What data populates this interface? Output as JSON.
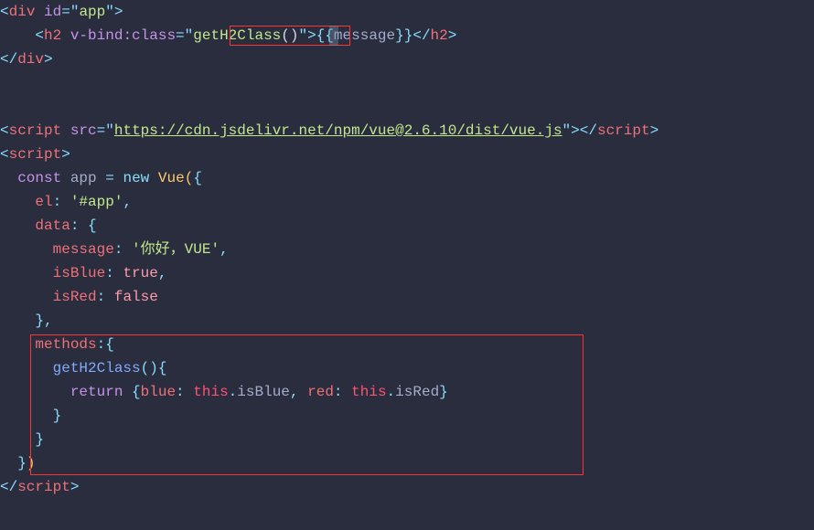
{
  "code": {
    "line1": {
      "tag_open": "<",
      "tag_name": "div",
      "attr_name": " id",
      "equals": "=",
      "quote1": "\"",
      "attr_value": "app",
      "quote2": "\"",
      "tag_close": ">"
    },
    "line2": {
      "indent": "    ",
      "tag_open": "<",
      "tag_name": "h2",
      "space": " ",
      "attr_name": "v-bind:class",
      "equals": "=",
      "quote1": "\"",
      "method": "getH2Class",
      "paren_open": "(",
      "paren_close": ")",
      "quote2": "\"",
      "tag_close": ">",
      "mustache_open": "{{",
      "mustache_var": "message",
      "mustache_close": "}}",
      "tag_close2_open": "</",
      "tag_name2": "h2",
      "tag_close2": ">"
    },
    "line3": {
      "tag_open": "</",
      "tag_name": "div",
      "tag_close": ">"
    },
    "line6": {
      "tag_open": "<",
      "tag_name": "script",
      "space": " ",
      "attr_name": "src",
      "equals": "=",
      "quote1": "\"",
      "url": "https://cdn.jsdelivr.net/npm/vue@2.6.10/dist/vue.js",
      "quote2": "\"",
      "tag_close": ">",
      "tag_close2_open": "</",
      "tag_name2": "script",
      "tag_close2": ">"
    },
    "line7": {
      "tag_open": "<",
      "tag_name": "script",
      "tag_close": ">"
    },
    "line8": {
      "indent": "  ",
      "const": "const",
      "space1": " ",
      "varname": "app",
      "space2": " ",
      "equals": "=",
      "space3": " ",
      "new": "new",
      "space4": " ",
      "classname": "Vue",
      "paren_open": "(",
      "brace_open": "{"
    },
    "line9": {
      "indent": "    ",
      "key": "el",
      "colon": ":",
      "space": " ",
      "value": "'#app'",
      "comma": ","
    },
    "line10": {
      "indent": "    ",
      "key": "data",
      "colon": ":",
      "space": " ",
      "brace": "{"
    },
    "line11": {
      "indent": "      ",
      "key": "message",
      "colon": ":",
      "space": " ",
      "value": "'你好，VUE'",
      "comma": ","
    },
    "line12": {
      "indent": "      ",
      "key": "isBlue",
      "colon": ":",
      "space": " ",
      "value": "true",
      "comma": ","
    },
    "line13": {
      "indent": "      ",
      "key": "isRed",
      "colon": ":",
      "space": " ",
      "value": "false"
    },
    "line14": {
      "indent": "    ",
      "brace": "}",
      "comma": ","
    },
    "line15": {
      "indent": "    ",
      "key": "methods",
      "colon": ":",
      "brace": "{"
    },
    "line16": {
      "indent": "      ",
      "method": "getH2Class",
      "paren_open": "(",
      "paren_close": ")",
      "brace": "{"
    },
    "line17": {
      "indent": "        ",
      "return": "return",
      "space1": " ",
      "brace_open": "{",
      "key1": "blue",
      "colon1": ":",
      "space2": " ",
      "this1": "this",
      "dot1": ".",
      "prop1": "isBlue",
      "comma": ",",
      "space3": " ",
      "key2": "red",
      "colon2": ":",
      "space4": " ",
      "this2": "this",
      "dot2": ".",
      "prop2": "isRed",
      "brace_close": "}"
    },
    "line18": {
      "indent": "      ",
      "brace": "}"
    },
    "line19": {
      "indent": "    ",
      "brace": "}"
    },
    "line20": {
      "indent": "  ",
      "brace": "}",
      "paren": ")"
    },
    "line21": {
      "tag_open": "</",
      "tag_name": "script",
      "tag_close": ">"
    }
  }
}
